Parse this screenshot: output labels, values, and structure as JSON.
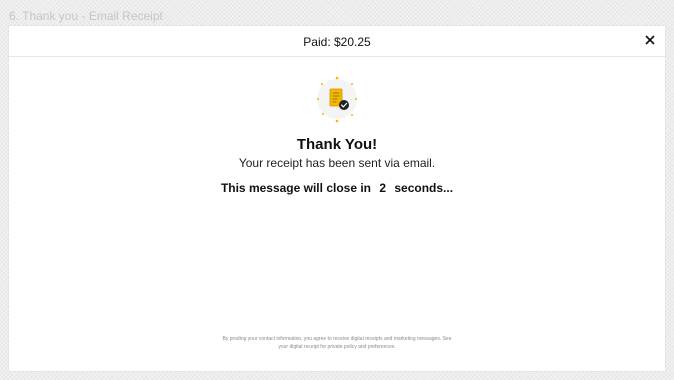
{
  "frame": {
    "title": "6. Thank you - Email Receipt"
  },
  "modal": {
    "header": {
      "paid_label": "Paid: $20.25",
      "close_icon": "close-icon"
    },
    "illustration_icon": "receipt-check-icon",
    "title": "Thank You!",
    "subtitle": "Your receipt has been sent via email.",
    "countdown": {
      "prefix": "This message will close in",
      "seconds": "2",
      "suffix": "seconds..."
    },
    "disclaimer": "By proding your contact information, you agree to receive digital receipts and marketing messages. See your digital receipt for private policy and preferences."
  },
  "colors": {
    "accent": "#f5b800",
    "check_badge": "#222222"
  }
}
